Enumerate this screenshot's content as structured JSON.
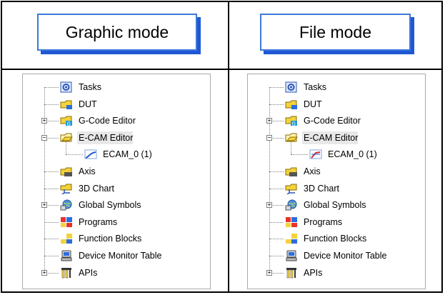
{
  "modes": {
    "left": "Graphic mode",
    "right": "File mode"
  },
  "tree_left": [
    {
      "label": "Tasks",
      "icon": "tasks-icon",
      "level": 0,
      "expander": null
    },
    {
      "label": "DUT",
      "icon": "dut-icon",
      "level": 0,
      "expander": null
    },
    {
      "label": "G-Code Editor",
      "icon": "gcode-editor-icon",
      "level": 0,
      "expander": "+"
    },
    {
      "label": "E-CAM Editor",
      "icon": "ecam-editor-icon",
      "level": 0,
      "expander": "-",
      "selected": true
    },
    {
      "label": "ECAM_0 (1)",
      "icon": "ecam-curve-icon",
      "level": 1,
      "expander": null
    },
    {
      "label": "Axis",
      "icon": "axis-icon",
      "level": 0,
      "expander": null
    },
    {
      "label": "3D Chart",
      "icon": "chart-3d-icon",
      "level": 0,
      "expander": null
    },
    {
      "label": "Global Symbols",
      "icon": "global-symbols-icon",
      "level": 0,
      "expander": "+"
    },
    {
      "label": "Programs",
      "icon": "programs-icon",
      "level": 0,
      "expander": null
    },
    {
      "label": "Function Blocks",
      "icon": "function-blocks-icon",
      "level": 0,
      "expander": null
    },
    {
      "label": "Device Monitor Table",
      "icon": "device-monitor-icon",
      "level": 0,
      "expander": null
    },
    {
      "label": "APIs",
      "icon": "apis-icon",
      "level": 0,
      "expander": "+"
    }
  ],
  "tree_right": [
    {
      "label": "Tasks",
      "icon": "tasks-icon",
      "level": 0,
      "expander": null
    },
    {
      "label": "DUT",
      "icon": "dut-icon",
      "level": 0,
      "expander": null
    },
    {
      "label": "G-Code Editor",
      "icon": "gcode-editor-icon",
      "level": 0,
      "expander": "+"
    },
    {
      "label": "E-CAM Editor",
      "icon": "ecam-editor-icon",
      "level": 0,
      "expander": "-",
      "selected": true
    },
    {
      "label": "ECAM_0 (1)",
      "icon": "ecam-file-icon",
      "level": 1,
      "expander": null
    },
    {
      "label": "Axis",
      "icon": "axis-icon",
      "level": 0,
      "expander": null
    },
    {
      "label": "3D Chart",
      "icon": "chart-3d-icon",
      "level": 0,
      "expander": null
    },
    {
      "label": "Global Symbols",
      "icon": "global-symbols-icon",
      "level": 0,
      "expander": "+"
    },
    {
      "label": "Programs",
      "icon": "programs-icon",
      "level": 0,
      "expander": null
    },
    {
      "label": "Function Blocks",
      "icon": "function-blocks-icon",
      "level": 0,
      "expander": null
    },
    {
      "label": "Device Monitor Table",
      "icon": "device-monitor-icon",
      "level": 0,
      "expander": null
    },
    {
      "label": "APIs",
      "icon": "apis-icon",
      "level": 0,
      "expander": "+"
    }
  ]
}
